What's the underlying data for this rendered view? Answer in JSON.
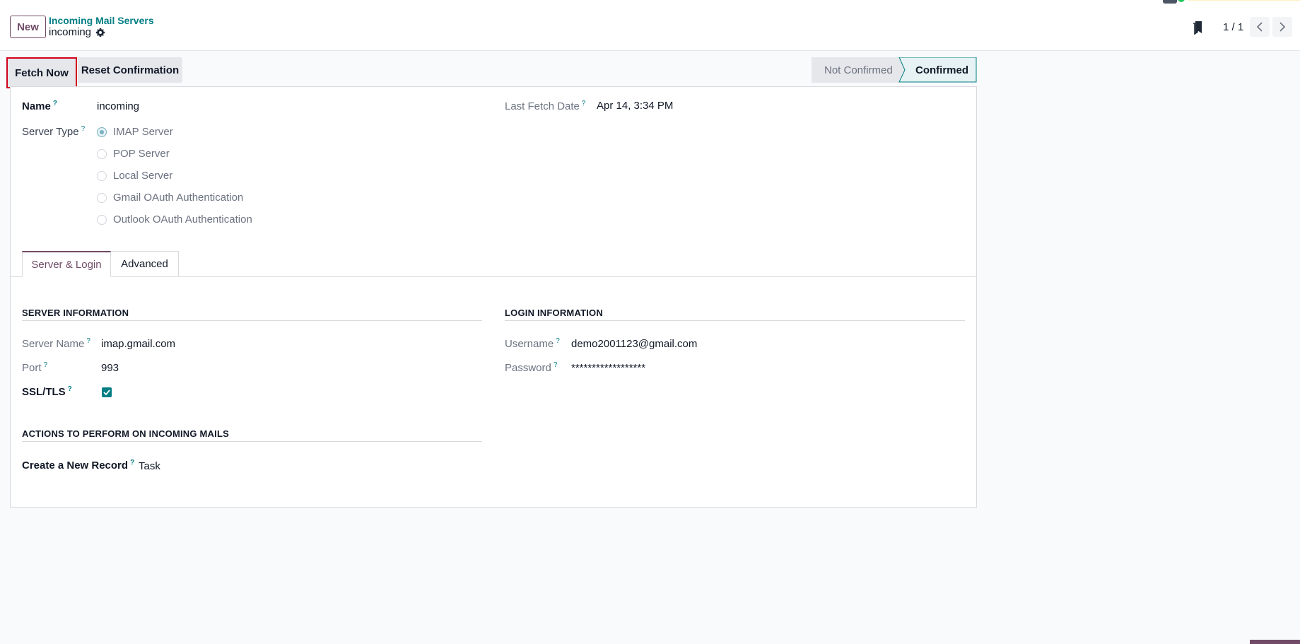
{
  "control_panel": {
    "new_label": "New",
    "breadcrumb_parent": "Incoming Mail Servers",
    "breadcrumb_current": "incoming",
    "pager_value": "1 / 1"
  },
  "status_bar": {
    "fetch_now_label": "Fetch Now",
    "reset_confirmation_label": "Reset Confirmation",
    "stages": [
      "Not Confirmed",
      "Confirmed"
    ],
    "active_stage": "Confirmed"
  },
  "form": {
    "name_label": "Name",
    "name_value": "incoming",
    "server_type_label": "Server Type",
    "server_types": [
      "IMAP Server",
      "POP Server",
      "Local Server",
      "Gmail OAuth Authentication",
      "Outlook OAuth Authentication"
    ],
    "server_type_selected": "IMAP Server",
    "last_fetch_label": "Last Fetch Date",
    "last_fetch_value": "Apr 14, 3:34 PM",
    "help_mark": "?"
  },
  "tabs": [
    "Server & Login",
    "Advanced"
  ],
  "active_tab": "Server & Login",
  "server_info": {
    "title": "SERVER INFORMATION",
    "server_name_label": "Server Name",
    "server_name_value": "imap.gmail.com",
    "port_label": "Port",
    "port_value": "993",
    "ssl_label": "SSL/TLS",
    "ssl_checked": true
  },
  "login_info": {
    "title": "LOGIN INFORMATION",
    "username_label": "Username",
    "username_value": "demo2001123@gmail.com",
    "password_label": "Password",
    "password_value": "******************"
  },
  "actions": {
    "title": "ACTIONS TO PERFORM ON INCOMING MAILS",
    "create_record_label": "Create a New Record",
    "create_record_value": "Task"
  },
  "colors": {
    "brand": "#714b67",
    "accent": "#017e84",
    "highlight_border": "#d0021b"
  }
}
